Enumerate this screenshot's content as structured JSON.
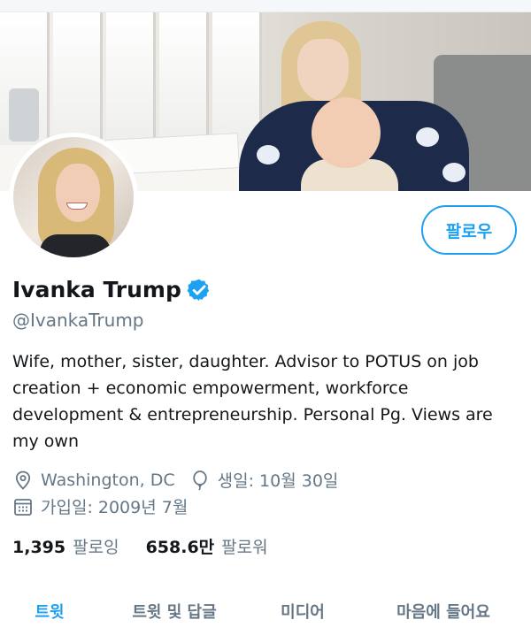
{
  "profile": {
    "name": "Ivanka Trump",
    "handle": "@IvankaTrump",
    "bio": "Wife, mother, sister, daughter. Advisor to POTUS on job creation + economic empowerment, workforce development & entrepreneurship. Personal Pg. Views are my own",
    "location": "Washington, DC",
    "birthday": "생일: 10월 30일",
    "joined": "가입일: 2009년 7월",
    "verified": true
  },
  "actions": {
    "follow_label": "팔로우"
  },
  "stats": {
    "following_count": "1,395",
    "following_label": "팔로잉",
    "followers_count": "658.6만",
    "followers_label": "팔로워"
  },
  "tabs": [
    {
      "label": "트윗",
      "active": true
    },
    {
      "label": "트윗 및 답글",
      "active": false
    },
    {
      "label": "미디어",
      "active": false
    },
    {
      "label": "마음에 들어요",
      "active": false
    }
  ],
  "colors": {
    "accent": "#1da1f2",
    "secondary_text": "#657786",
    "primary_text": "#14171a"
  },
  "icons": {
    "location": "location-pin-icon",
    "birthday": "balloon-icon",
    "joined": "calendar-icon",
    "verified": "verified-badge-icon"
  }
}
